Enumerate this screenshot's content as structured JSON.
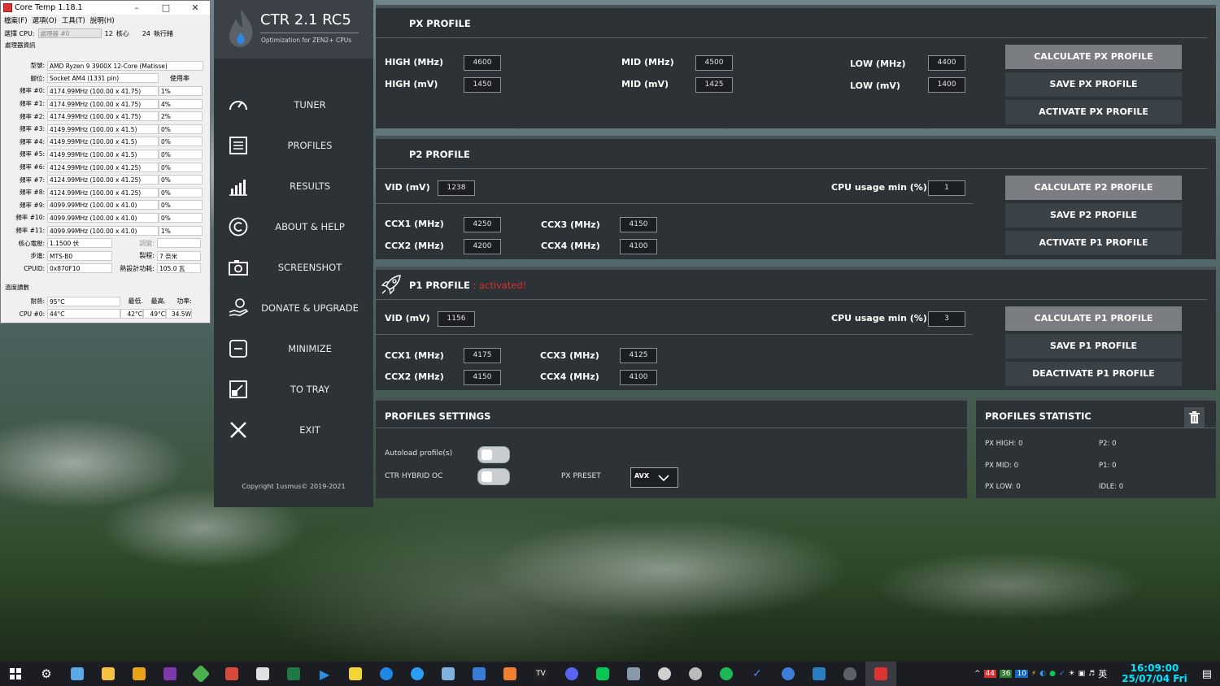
{
  "coretemp": {
    "title": "Core Temp 1.18.1",
    "menu": [
      "檔案(F)",
      "選項(O)",
      "工具(T)",
      "說明(H)"
    ],
    "cpu_select_label": "選擇 CPU:",
    "cpu_select_value": "處理器 #0",
    "cores": "12",
    "cores_label": "核心",
    "threads": "24",
    "threads_label": "執行緒",
    "group_label": "處理器資訊",
    "model_label": "型號:",
    "model": "AMD Ryzen 9 3900X 12-Core (Matisse)",
    "socket_label": "腳位:",
    "socket": "Socket AM4 (1331 pin)",
    "usage_label": "使用率",
    "freqs": [
      {
        "label": "頻率 #0:",
        "value": "4174.99MHz (100.00 x 41.75)",
        "usage": "1%"
      },
      {
        "label": "頻率 #1:",
        "value": "4174.99MHz (100.00 x 41.75)",
        "usage": "4%"
      },
      {
        "label": "頻率 #2:",
        "value": "4174.99MHz (100.00 x 41.75)",
        "usage": "2%"
      },
      {
        "label": "頻率 #3:",
        "value": "4149.99MHz (100.00 x 41.5)",
        "usage": "0%"
      },
      {
        "label": "頻率 #4:",
        "value": "4149.99MHz (100.00 x 41.5)",
        "usage": "0%"
      },
      {
        "label": "頻率 #5:",
        "value": "4149.99MHz (100.00 x 41.5)",
        "usage": "0%"
      },
      {
        "label": "頻率 #6:",
        "value": "4124.99MHz (100.00 x 41.25)",
        "usage": "0%"
      },
      {
        "label": "頻率 #7:",
        "value": "4124.99MHz (100.00 x 41.25)",
        "usage": "0%"
      },
      {
        "label": "頻率 #8:",
        "value": "4124.99MHz (100.00 x 41.25)",
        "usage": "0%"
      },
      {
        "label": "頻率 #9:",
        "value": "4099.99MHz (100.00 x 41.0)",
        "usage": "0%"
      },
      {
        "label": "頻率 #10:",
        "value": "4099.99MHz (100.00 x 41.0)",
        "usage": "0%"
      },
      {
        "label": "頻率 #11:",
        "value": "4099.99MHz (100.00 x 41.0)",
        "usage": "1%"
      }
    ],
    "vcore_label": "核心電壓:",
    "vcore": "1.1500 伏",
    "mod_label": "調變:",
    "stepping_label": "步進:",
    "stepping": "MTS-B0",
    "process_label": "製程:",
    "process": "7 奈米",
    "cpuid_label": "CPUID:",
    "cpuid": "0x870F10",
    "tdp_label": "熱設計功耗:",
    "tdp": "105.0 瓦",
    "temp_group": "溫度讀數",
    "tjmax_label": "耐熱:",
    "tjmax": "95°C",
    "min_label": "最低.",
    "max_label": "最高.",
    "power_label": "功率:",
    "cpu0_label": "CPU #0:",
    "cpu0": "44°C",
    "cpu0_min": "42°C",
    "cpu0_max": "49°C",
    "cpu0_power": "34.5W"
  },
  "ctr": {
    "title": "CTR 2.1 RC5",
    "subtitle": "Optimization for ZEN2+ CPUs",
    "nav": [
      "TUNER",
      "PROFILES",
      "RESULTS",
      "ABOUT & HELP",
      "SCREENSHOT",
      "DONATE & UPGRADE",
      "MINIMIZE",
      "TO TRAY",
      "EXIT"
    ],
    "copyright": "Copyright 1usmus© 2019-2021",
    "px": {
      "title": "PX PROFILE",
      "high_mhz_label": "HIGH (MHz)",
      "high_mhz": "4600",
      "mid_mhz_label": "MID (MHz)",
      "mid_mhz": "4500",
      "low_mhz_label": "LOW (MHz)",
      "low_mhz": "4400",
      "high_mv_label": "HIGH  (mV)",
      "high_mv": "1450",
      "mid_mv_label": "MID (mV)",
      "mid_mv": "1425",
      "low_mv_label": "LOW (mV)",
      "low_mv": "1400",
      "buttons": [
        "CALCULATE PX PROFILE",
        "SAVE PX PROFILE",
        "ACTIVATE PX PROFILE"
      ]
    },
    "p2": {
      "title": "P2 PROFILE",
      "vid_label": "VID (mV)",
      "vid": "1238",
      "usage_label": "CPU usage min (%)",
      "usage": "1",
      "ccx1_label": "CCX1 (MHz)",
      "ccx1": "4250",
      "ccx2_label": "CCX2 (MHz)",
      "ccx2": "4200",
      "ccx3_label": "CCX3 (MHz)",
      "ccx3": "4150",
      "ccx4_label": "CCX4 (MHz)",
      "ccx4": "4100",
      "buttons": [
        "CALCULATE P2 PROFILE",
        "SAVE P2 PROFILE",
        "ACTIVATE P1 PROFILE"
      ]
    },
    "p1": {
      "title": "P1 PROFILE",
      "status": " : activated!",
      "vid_label": "VID (mV)",
      "vid": "1156",
      "usage_label": "CPU usage min (%)",
      "usage": "3",
      "ccx1_label": "CCX1 (MHz)",
      "ccx1": "4175",
      "ccx2_label": "CCX2 (MHz)",
      "ccx2": "4150",
      "ccx3_label": "CCX3 (MHz)",
      "ccx3": "4125",
      "ccx4_label": "CCX4 (MHz)",
      "ccx4": "4100",
      "buttons": [
        "CALCULATE P1 PROFILE",
        "SAVE P1 PROFILE",
        "DEACTIVATE P1 PROFILE"
      ]
    },
    "settings": {
      "title": "PROFILES SETTINGS",
      "autoload": "Autoload profile(s)",
      "hybrid": "CTR HYBRID OC",
      "preset_label": "PX PRESET",
      "preset": "AVX"
    },
    "stats": {
      "title": "PROFILES STATISTIC",
      "px_high": "PX HIGH: 0",
      "px_mid": "PX MID: 0",
      "px_low": "PX LOW: 0",
      "p2": "P2: 0",
      "p1": "P1: 0",
      "idle": "IDLE: 0"
    },
    "accent": "#d93030"
  },
  "taskbar": {
    "tray": [
      "^",
      "44",
      "36",
      "10"
    ],
    "lang": "英",
    "time": "16:09:00",
    "date": "25/07/04 Fri"
  }
}
